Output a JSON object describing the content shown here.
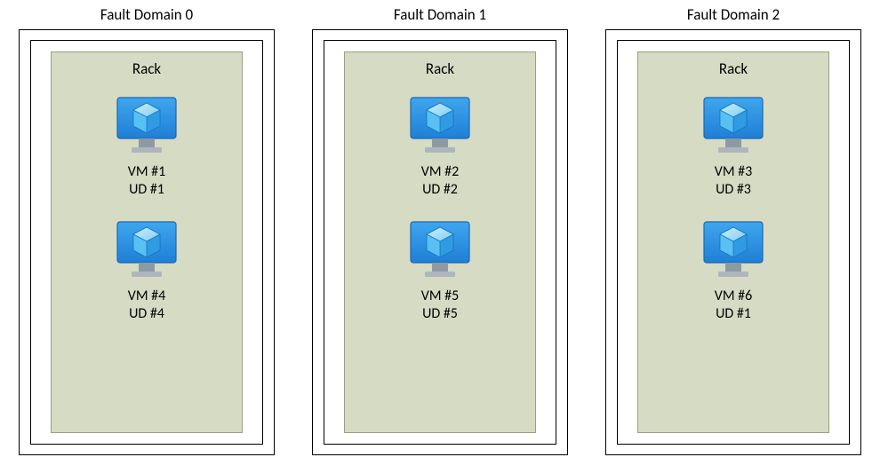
{
  "fault_domains": [
    {
      "title": "Fault Domain 0",
      "rack_label": "Rack",
      "vms": [
        {
          "vm": "VM #1",
          "ud": "UD #1"
        },
        {
          "vm": "VM #4",
          "ud": "UD #4"
        }
      ]
    },
    {
      "title": "Fault Domain 1",
      "rack_label": "Rack",
      "vms": [
        {
          "vm": "VM #2",
          "ud": "UD #2"
        },
        {
          "vm": "VM #5",
          "ud": "UD #5"
        }
      ]
    },
    {
      "title": "Fault Domain 2",
      "rack_label": "Rack",
      "vms": [
        {
          "vm": "VM #3",
          "ud": "UD #3"
        },
        {
          "vm": "VM #6",
          "ud": "UD #1"
        }
      ]
    }
  ]
}
